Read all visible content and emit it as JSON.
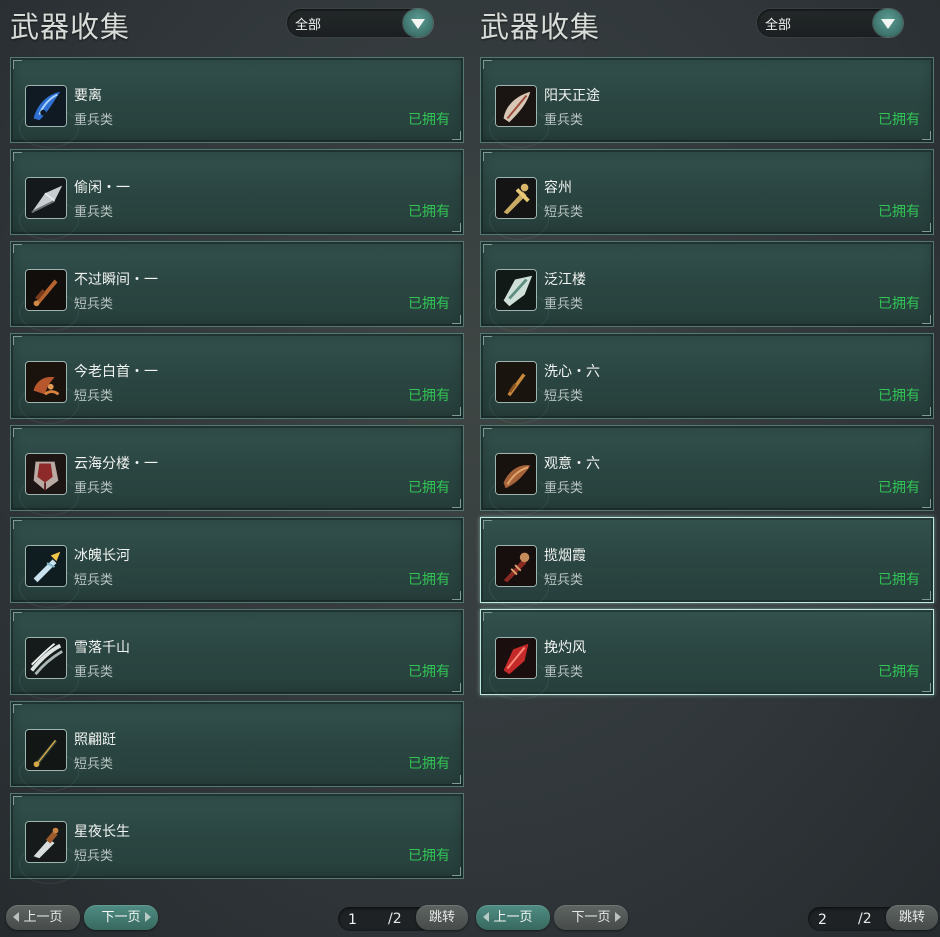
{
  "colors": {
    "owned": "#30c454",
    "accent": "#4f8d84",
    "card_bg": "#2f4b47"
  },
  "panels": [
    {
      "title": "武器收集",
      "filter": {
        "selected": "全部"
      },
      "items": [
        {
          "name": "要离",
          "type": "重兵类",
          "status": "已拥有",
          "icon": "blue-crescent-blade-icon"
        },
        {
          "name": "偷闲・一",
          "type": "重兵类",
          "status": "已拥有",
          "icon": "silver-leaf-blade-icon"
        },
        {
          "name": "不过瞬间・一",
          "type": "短兵类",
          "status": "已拥有",
          "icon": "bronze-short-sword-icon"
        },
        {
          "name": "今老白首・一",
          "type": "短兵类",
          "status": "已拥有",
          "icon": "bronze-hook-blade-icon"
        },
        {
          "name": "云海分楼・一",
          "type": "重兵类",
          "status": "已拥有",
          "icon": "red-broad-blade-icon"
        },
        {
          "name": "冰魄长河",
          "type": "短兵类",
          "status": "已拥有",
          "icon": "ice-crystal-sword-icon"
        },
        {
          "name": "雪落千山",
          "type": "重兵类",
          "status": "已拥有",
          "icon": "white-claw-blade-icon"
        },
        {
          "name": "照翩跹",
          "type": "短兵类",
          "status": "已拥有",
          "icon": "gold-dagger-icon"
        },
        {
          "name": "星夜长生",
          "type": "短兵类",
          "status": "已拥有",
          "icon": "steel-dagger-icon"
        }
      ],
      "pagination": {
        "prev": "上一页",
        "next": "下一页",
        "current": "1",
        "total": "/2",
        "jump": "跳转"
      }
    },
    {
      "title": "武器收集",
      "filter": {
        "selected": "全部"
      },
      "items": [
        {
          "name": "阳天正途",
          "type": "重兵类",
          "status": "已拥有",
          "icon": "pale-leaf-blade-icon"
        },
        {
          "name": "容州",
          "type": "短兵类",
          "status": "已拥有",
          "icon": "gold-ornate-sword-icon"
        },
        {
          "name": "泛江楼",
          "type": "重兵类",
          "status": "已拥有",
          "icon": "jade-broad-blade-icon"
        },
        {
          "name": "洗心・六",
          "type": "短兵类",
          "status": "已拥有",
          "icon": "gold-short-dagger-icon"
        },
        {
          "name": "观意・六",
          "type": "重兵类",
          "status": "已拥有",
          "icon": "copper-curved-blade-icon"
        },
        {
          "name": "揽烟霞",
          "type": "短兵类",
          "status": "已拥有",
          "icon": "crimson-thorn-sword-icon"
        },
        {
          "name": "挽灼风",
          "type": "重兵类",
          "status": "已拥有",
          "icon": "red-crystal-blade-icon"
        }
      ],
      "pagination": {
        "prev": "上一页",
        "next": "下一页",
        "current": "2",
        "total": "/2",
        "jump": "跳转"
      }
    }
  ]
}
